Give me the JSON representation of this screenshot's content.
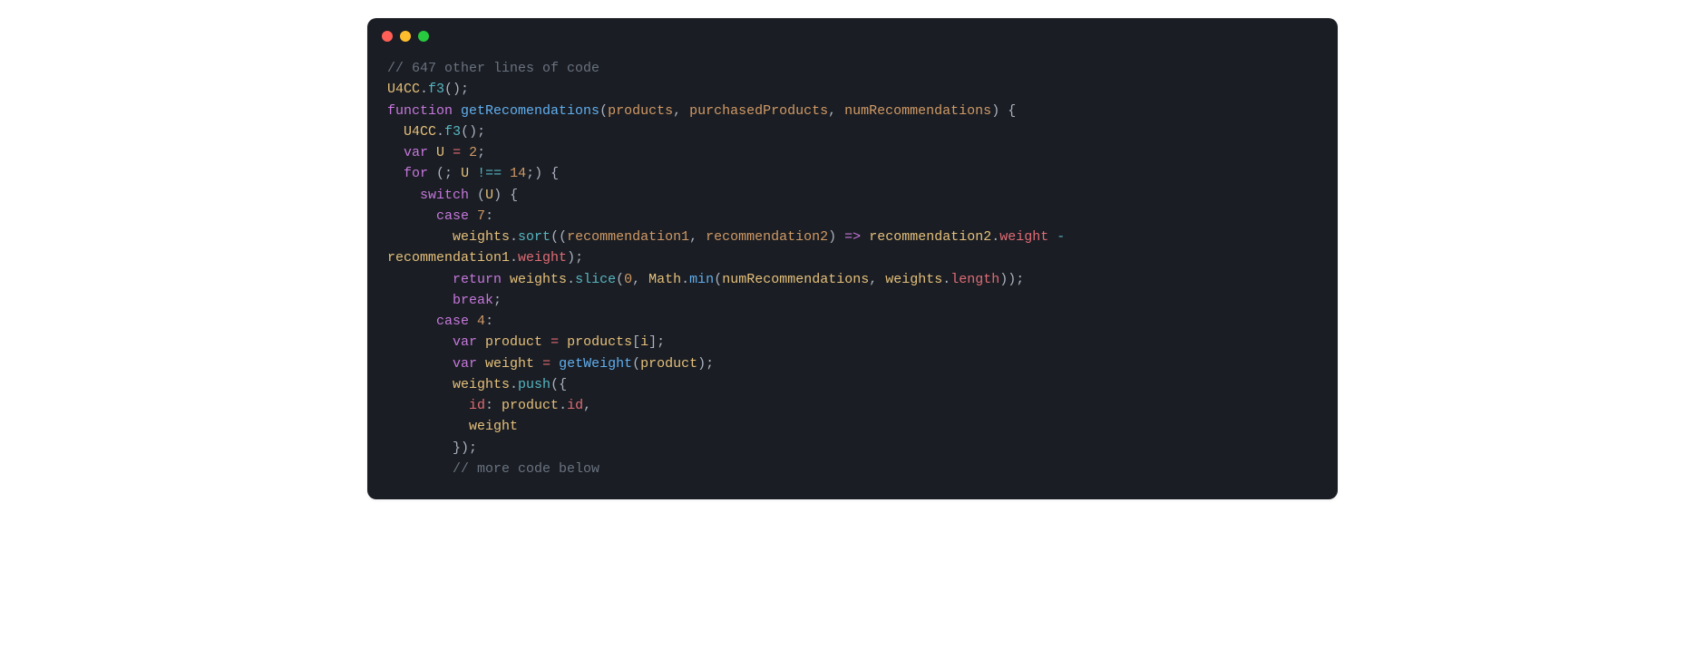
{
  "code": {
    "l0_comment": "// 647 other lines of code",
    "l1_u4cc": "U4CC",
    "l1_f3": "f3",
    "l2_function": "function",
    "l2_name": "getRecomendations",
    "l2_p1": "products",
    "l2_p2": "purchasedProducts",
    "l2_p3": "numRecommendations",
    "l3_u4cc": "U4CC",
    "l3_f3": "f3",
    "l4_var": "var",
    "l4_u": "U",
    "l4_eq": "=",
    "l4_2": "2",
    "l5_for": "for",
    "l5_u": "U",
    "l5_neq": "!==",
    "l5_14": "14",
    "l6_switch": "switch",
    "l6_u": "U",
    "l7_case": "case",
    "l7_7": "7",
    "l8_weights": "weights",
    "l8_sort": "sort",
    "l8_r1": "recommendation1",
    "l8_r2": "recommendation2",
    "l8_arrow": "=>",
    "l8_r2b": "recommendation2",
    "l8_w1": "weight",
    "l8_minus": "-",
    "l9_r1": "recommendation1",
    "l9_w": "weight",
    "l10_return": "return",
    "l10_weights": "weights",
    "l10_slice": "slice",
    "l10_0": "0",
    "l10_math": "Math",
    "l10_min": "min",
    "l10_nr": "numRecommendations",
    "l10_weights2": "weights",
    "l10_len": "length",
    "l11_break": "break",
    "l12_case": "case",
    "l12_4": "4",
    "l13_var": "var",
    "l13_product": "product",
    "l13_eq": "=",
    "l13_products": "products",
    "l13_i": "i",
    "l14_var": "var",
    "l14_weight": "weight",
    "l14_eq": "=",
    "l14_getw": "getWeight",
    "l14_product": "product",
    "l15_weights": "weights",
    "l15_push": "push",
    "l16_id": "id",
    "l16_product": "product",
    "l16_pid": "id",
    "l17_weight": "weight",
    "l19_comment": "// more code below"
  }
}
